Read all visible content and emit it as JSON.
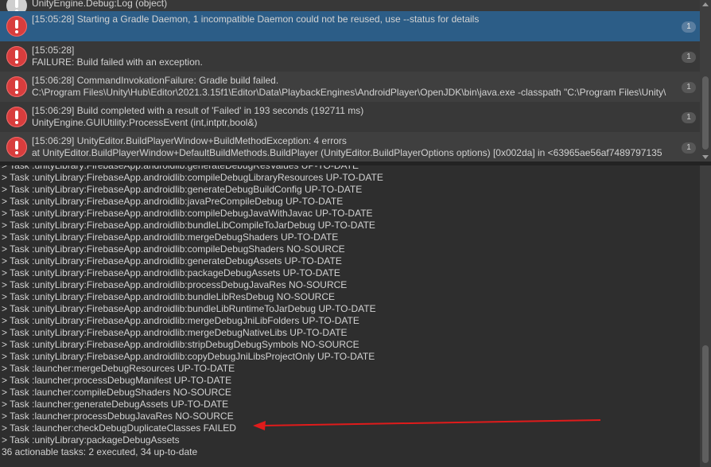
{
  "console": {
    "entries": [
      {
        "l1": "UnityEngine.Debug:Log (object)",
        "l2": "",
        "count": ""
      },
      {
        "l1": "[15:05:28] Starting a Gradle Daemon, 1 incompatible Daemon could not be reused, use --status for details",
        "l2": "",
        "count": "1"
      },
      {
        "l1": "[15:05:28]",
        "l2": "FAILURE: Build failed with an exception.",
        "count": "1"
      },
      {
        "l1": "[15:06:28] CommandInvokationFailure: Gradle build failed.",
        "l2": "C:\\Program Files\\Unity\\Hub\\Editor\\2021.3.15f1\\Editor\\Data\\PlaybackEngines\\AndroidPlayer\\OpenJDK\\bin\\java.exe -classpath \"C:\\Program Files\\Unity\\",
        "count": "1"
      },
      {
        "l1": "[15:06:29] Build completed with a result of 'Failed' in 193 seconds (192711 ms)",
        "l2": "UnityEngine.GUIUtility:ProcessEvent (int,intptr,bool&)",
        "count": "1"
      },
      {
        "l1": "[15:06:29] UnityEditor.BuildPlayerWindow+BuildMethodException: 4 errors",
        "l2": "  at UnityEditor.BuildPlayerWindow+DefaultBuildMethods.BuildPlayer (UnityEditor.BuildPlayerOptions options) [0x002da] in <63965ae56af7489797135",
        "count": "1"
      }
    ]
  },
  "detail": {
    "lines": [
      "> Task :unityLibrary:FirebaseApp.androidlib:generateDebugResValues UP-TO-DATE",
      "> Task :unityLibrary:FirebaseApp.androidlib:compileDebugLibraryResources UP-TO-DATE",
      "> Task :unityLibrary:FirebaseApp.androidlib:generateDebugBuildConfig UP-TO-DATE",
      "> Task :unityLibrary:FirebaseApp.androidlib:javaPreCompileDebug UP-TO-DATE",
      "> Task :unityLibrary:FirebaseApp.androidlib:compileDebugJavaWithJavac UP-TO-DATE",
      "> Task :unityLibrary:FirebaseApp.androidlib:bundleLibCompileToJarDebug UP-TO-DATE",
      "> Task :unityLibrary:FirebaseApp.androidlib:mergeDebugShaders UP-TO-DATE",
      "> Task :unityLibrary:FirebaseApp.androidlib:compileDebugShaders NO-SOURCE",
      "> Task :unityLibrary:FirebaseApp.androidlib:generateDebugAssets UP-TO-DATE",
      "> Task :unityLibrary:FirebaseApp.androidlib:packageDebugAssets UP-TO-DATE",
      "> Task :unityLibrary:FirebaseApp.androidlib:processDebugJavaRes NO-SOURCE",
      "> Task :unityLibrary:FirebaseApp.androidlib:bundleLibResDebug NO-SOURCE",
      "> Task :unityLibrary:FirebaseApp.androidlib:bundleLibRuntimeToJarDebug UP-TO-DATE",
      "> Task :unityLibrary:FirebaseApp.androidlib:mergeDebugJniLibFolders UP-TO-DATE",
      "> Task :unityLibrary:FirebaseApp.androidlib:mergeDebugNativeLibs UP-TO-DATE",
      "> Task :unityLibrary:FirebaseApp.androidlib:stripDebugDebugSymbols NO-SOURCE",
      "> Task :unityLibrary:FirebaseApp.androidlib:copyDebugJniLibsProjectOnly UP-TO-DATE",
      "> Task :launcher:mergeDebugResources UP-TO-DATE",
      "> Task :launcher:processDebugManifest UP-TO-DATE",
      "> Task :launcher:compileDebugShaders NO-SOURCE",
      "> Task :launcher:generateDebugAssets UP-TO-DATE",
      "> Task :launcher:processDebugJavaRes NO-SOURCE",
      "> Task :launcher:checkDebugDuplicateClasses FAILED",
      "> Task :unityLibrary:packageDebugAssets",
      "36 actionable tasks: 2 executed, 34 up-to-date"
    ]
  },
  "colors": {
    "selected_row": "#2c5d87",
    "error_icon": "#d83d3d",
    "annotation_arrow": "#e01b1b"
  },
  "icons": {
    "entry_icon": "error-icon"
  }
}
